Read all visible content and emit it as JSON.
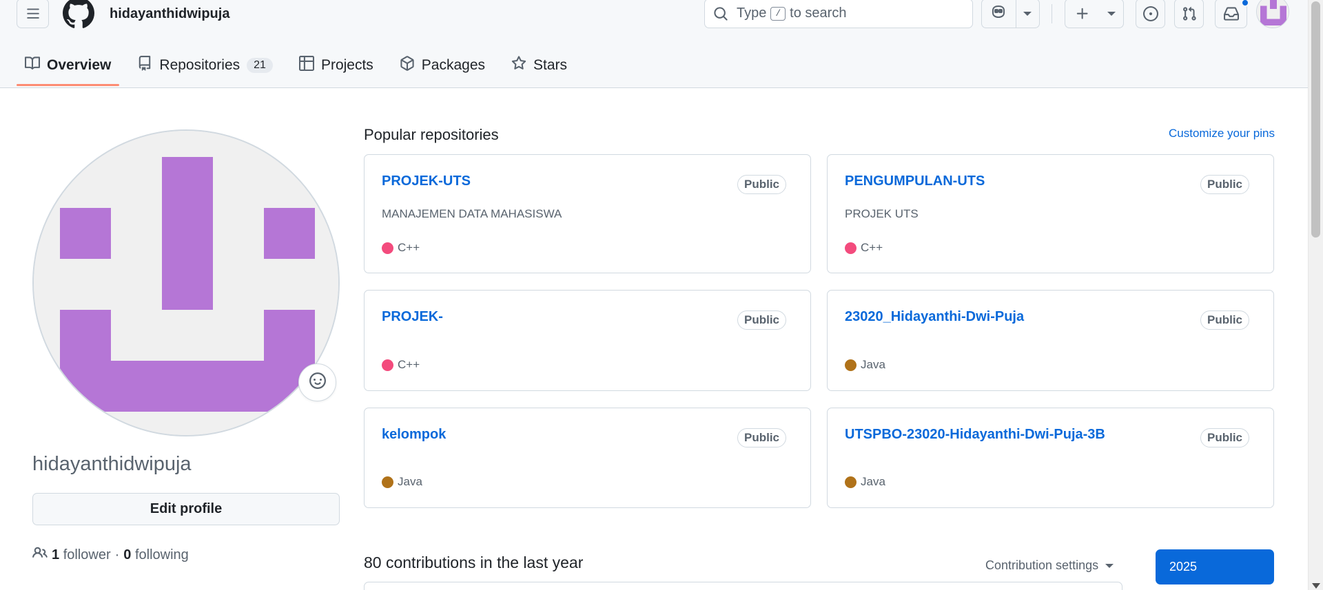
{
  "header": {
    "username": "hidayanthidwipuja",
    "search": {
      "prefix": "Type",
      "key": "/",
      "suffix": "to search"
    }
  },
  "tabs": [
    {
      "label": "Overview",
      "icon": "book-icon",
      "selected": true
    },
    {
      "label": "Repositories",
      "icon": "repo-icon",
      "count": "21"
    },
    {
      "label": "Projects",
      "icon": "table-icon"
    },
    {
      "label": "Packages",
      "icon": "package-icon"
    },
    {
      "label": "Stars",
      "icon": "star-icon"
    }
  ],
  "profile": {
    "login": "hidayanthidwipuja",
    "edit_label": "Edit profile",
    "followers_count": "1",
    "followers_label": "follower",
    "separator": "·",
    "following_count": "0",
    "following_label": "following"
  },
  "pinned": {
    "title": "Popular repositories",
    "customize_label": "Customize your pins",
    "repos": [
      {
        "name": "PROJEK-UTS",
        "visibility": "Public",
        "description": "MANAJEMEN DATA MAHASISWA",
        "language": "C++",
        "lang_color": "#f34b7d"
      },
      {
        "name": "PENGUMPULAN-UTS",
        "visibility": "Public",
        "description": "PROJEK UTS",
        "language": "C++",
        "lang_color": "#f34b7d"
      },
      {
        "name": "PROJEK-",
        "visibility": "Public",
        "description": "",
        "language": "C++",
        "lang_color": "#f34b7d"
      },
      {
        "name": "23020_Hidayanthi-Dwi-Puja",
        "visibility": "Public",
        "description": "",
        "language": "Java",
        "lang_color": "#b07219"
      },
      {
        "name": "kelompok",
        "visibility": "Public",
        "description": "",
        "language": "Java",
        "lang_color": "#b07219"
      },
      {
        "name": "UTSPBO-23020-Hidayanthi-Dwi-Puja-3B",
        "visibility": "Public",
        "description": "",
        "language": "Java",
        "lang_color": "#b07219"
      }
    ]
  },
  "contributions": {
    "title": "80 contributions in the last year",
    "settings_label": "Contribution settings",
    "year": "2025"
  },
  "colors": {
    "accent": "#0969da",
    "tab_underline": "#fd8c73",
    "avatar_purple": "#b576d6",
    "avatar_bg": "#f0f0f0"
  }
}
